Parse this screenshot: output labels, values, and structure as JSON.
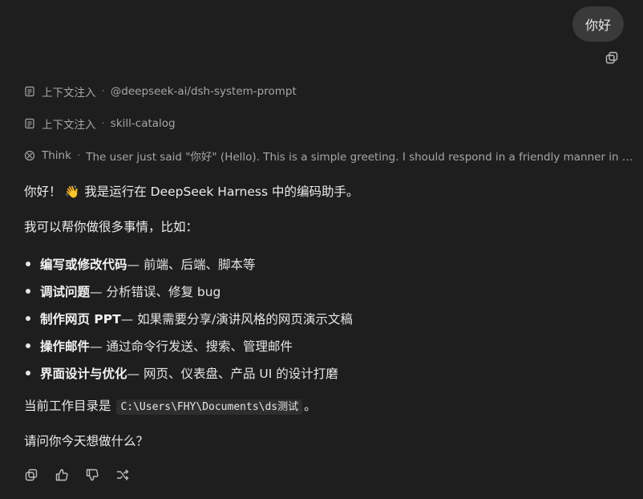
{
  "user_message": "你好",
  "context_rows": [
    {
      "label": "上下文注入",
      "value": "@deepseek-ai/dsh-system-prompt"
    },
    {
      "label": "上下文注入",
      "value": "skill-catalog"
    }
  ],
  "think": {
    "label": "Think",
    "text": "The user just said \"你好\" (Hello). This is a simple greeting. I should respond in a friendly manner in Chinese, ..."
  },
  "reply": {
    "greeting_a": "你好！",
    "greeting_emoji": "👋",
    "greeting_b": "我是运行在 DeepSeek Harness 中的编码助手。",
    "intro": "我可以帮你做很多事情，比如：",
    "bullets": [
      {
        "bold": "编写或修改代码",
        "rest": " — 前端、后端、脚本等"
      },
      {
        "bold": "调试问题",
        "rest": " — 分析错误、修复 bug"
      },
      {
        "bold": "制作网页 PPT",
        "rest": " — 如果需要分享/演讲风格的网页演示文稿"
      },
      {
        "bold": "操作邮件",
        "rest": " — 通过命令行发送、搜索、管理邮件"
      },
      {
        "bold": "界面设计与优化",
        "rest": " — 网页、仪表盘、产品 UI 的设计打磨"
      }
    ],
    "cwd_prefix": "当前工作目录是",
    "cwd_path": "C:\\Users\\FHY\\Documents\\ds测试",
    "cwd_suffix": "。",
    "question": "请问你今天想做什么？"
  },
  "icons": {
    "copy": "copy-icon",
    "doc": "document-icon",
    "think": "brain-icon",
    "like": "thumbs-up-icon",
    "dislike": "thumbs-down-icon",
    "regenerate": "regenerate-icon"
  }
}
